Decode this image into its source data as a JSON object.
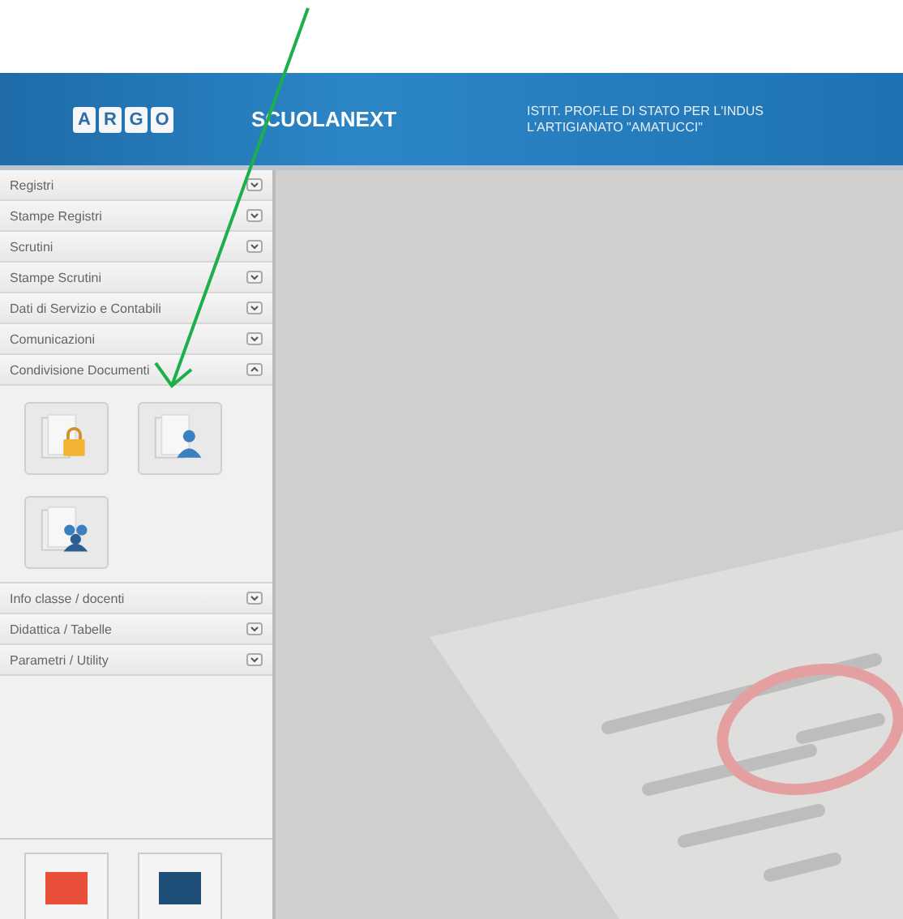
{
  "header": {
    "logo_letters": [
      "A",
      "R",
      "G",
      "O"
    ],
    "app_name": "SCUOLANEXT",
    "school_lines": [
      "ISTIT. PROF.LE DI STATO PER L'INDUS",
      "L'ARTIGIANATO \"AMATUCCI\""
    ]
  },
  "sidebar": {
    "items": [
      {
        "label": "Registri",
        "expanded": false
      },
      {
        "label": "Stampe Registri",
        "expanded": false
      },
      {
        "label": "Scrutini",
        "expanded": false
      },
      {
        "label": "Stampe Scrutini",
        "expanded": false
      },
      {
        "label": "Dati di Servizio e Contabili",
        "expanded": false
      },
      {
        "label": "Comunicazioni",
        "expanded": false
      },
      {
        "label": "Condivisione Documenti",
        "expanded": true,
        "tiles": [
          {
            "kind": "lock"
          },
          {
            "kind": "user"
          },
          {
            "kind": "group"
          }
        ]
      },
      {
        "label": "Info classe / docenti",
        "expanded": false
      },
      {
        "label": "Didattica / Tabelle",
        "expanded": false
      },
      {
        "label": "Parametri / Utility",
        "expanded": false
      }
    ],
    "footer_buttons": [
      {
        "color": "#e8503a"
      },
      {
        "color": "#1f4e79"
      }
    ]
  }
}
